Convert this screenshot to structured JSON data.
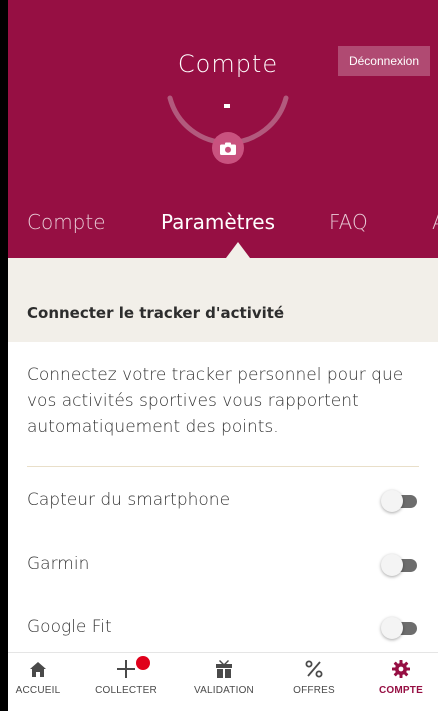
{
  "header": {
    "title": "Compte",
    "logout_label": "Déconnexion"
  },
  "tabs": [
    {
      "label": "Compte",
      "active": false
    },
    {
      "label": "Paramètres",
      "active": true
    },
    {
      "label": "FAQ",
      "active": false
    },
    {
      "label": "A",
      "active": false
    }
  ],
  "section": {
    "title": "Connecter le tracker d'activité",
    "description": "Connectez votre tracker personnel pour que vos activités sportives vous rapportent automatiquement des points."
  },
  "trackers": [
    {
      "label": "Capteur du smartphone",
      "enabled": false
    },
    {
      "label": "Garmin",
      "enabled": false
    },
    {
      "label": "Google Fit",
      "enabled": false
    }
  ],
  "nav": [
    {
      "label": "ACCUEIL",
      "icon": "home-icon",
      "active": false
    },
    {
      "label": "COLLECTER",
      "icon": "plus-icon",
      "active": false,
      "badge": true
    },
    {
      "label": "VALIDATION",
      "icon": "gift-icon",
      "active": false
    },
    {
      "label": "OFFRES",
      "icon": "percent-icon",
      "active": false
    },
    {
      "label": "COMPTE",
      "icon": "gear-icon",
      "active": true
    }
  ],
  "colors": {
    "brand": "#960f43",
    "band": "#f2efe9",
    "badge": "#e0001b"
  }
}
